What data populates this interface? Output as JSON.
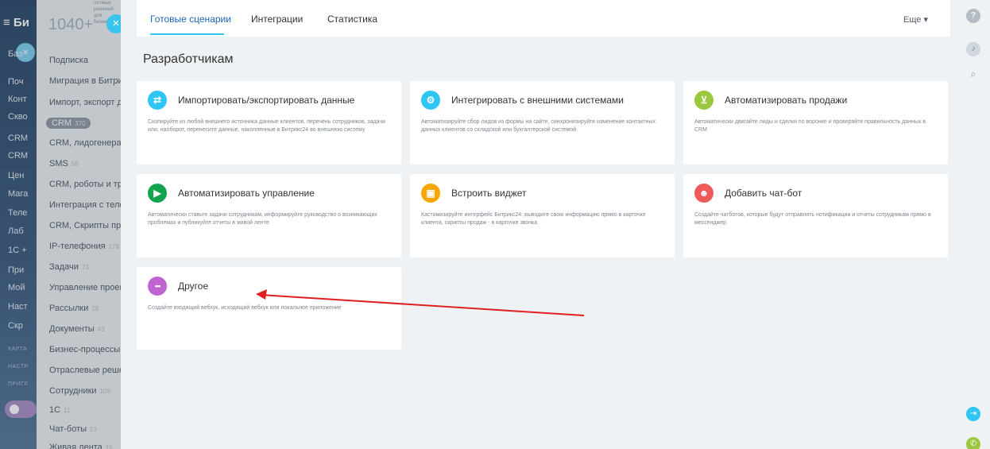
{
  "app_sidebar": {
    "brand": "≡ Би",
    "items": [
      "Баз",
      "Поч",
      "Конт",
      "Скво",
      "CRM",
      "CRM",
      "Цен",
      "Мага",
      "Теле",
      "Лаб",
      "1С +",
      "При",
      "Мой",
      "Наст",
      "Скр"
    ],
    "small_labels": [
      "КАРТА",
      "НАСТР",
      "ПРИГЛ"
    ],
    "close_glyph": "×"
  },
  "menu": {
    "count": "1040+",
    "count_desc": "готовых решений для Бизнеса",
    "close_glyph": "×",
    "items": [
      {
        "label": "Подписка",
        "count": ""
      },
      {
        "label": "Миграция в Битрикс",
        "count": ""
      },
      {
        "label": "Импорт, экспорт дан",
        "count": ""
      },
      {
        "label": "CRM",
        "count": "370"
      },
      {
        "label": "CRM, лидогенерация",
        "count": ""
      },
      {
        "label": "SMS",
        "count": "58"
      },
      {
        "label": "CRM, роботы и триг",
        "count": ""
      },
      {
        "label": "Интеграция с телеф",
        "count": ""
      },
      {
        "label": "CRM, Скрипты прод",
        "count": ""
      },
      {
        "label": "IP-телефония",
        "count": "178"
      },
      {
        "label": "Задачи",
        "count": "73"
      },
      {
        "label": "Управление проекта",
        "count": ""
      },
      {
        "label": "Рассылки",
        "count": "28"
      },
      {
        "label": "Документы",
        "count": "43"
      },
      {
        "label": "Бизнес-процессы",
        "count": "85"
      },
      {
        "label": "Отраслевые решени",
        "count": ""
      },
      {
        "label": "Сотрудники",
        "count": "109"
      },
      {
        "label": "1С",
        "count": "11"
      },
      {
        "label": "Чат-боты",
        "count": "53"
      },
      {
        "label": "Живая лента",
        "count": "16"
      }
    ]
  },
  "tabs": [
    {
      "label": "Готовые сценарии",
      "active": true
    },
    {
      "label": "Интеграции",
      "active": false
    },
    {
      "label": "Статистика",
      "active": false
    }
  ],
  "more_label": "Еще ▾",
  "page_title": "Разработчикам",
  "cards": [
    {
      "title": "Импортировать/экспортировать данные",
      "desc": "Скопируйте из любой внешнего источника данные клиентов, перечень сотрудников, задачи или, наоборот, перенесите данные, накопленные в Битрикс24 во внешнюю систему",
      "icon": "swap-icon",
      "glyph": "⇄",
      "color": "#2fc6f6"
    },
    {
      "title": "Интегрировать с внешними системами",
      "desc": "Автоматизируйте сбор лидов из формы на сайте, синхронизируйте изменение контактных данных клиентов со складской или бухгалтерской системой",
      "icon": "gears-icon",
      "glyph": "⚙",
      "color": "#2fc6f6"
    },
    {
      "title": "Автоматизировать продажи",
      "desc": "Автоматически двигайте лиды и сделки по воронке и проверяйте правильность данных в CRM",
      "icon": "cart-icon",
      "glyph": "⊻",
      "color": "#9bc83e"
    },
    {
      "title": "Автоматизировать управление",
      "desc": "Автоматически ставьте задачи сотрудникам, информируйте руководство о возникающих проблемах и публикуйте отчеты в живой ленте",
      "icon": "play-icon",
      "glyph": "▶",
      "color": "#12a44e"
    },
    {
      "title": "Встроить виджет",
      "desc": "Кастомизируйте интерфейс Битрикс24: выводите свою информацию прямо в карточке клиента, скрипты продаж - в карточке звонка",
      "icon": "widget-icon",
      "glyph": "▣",
      "color": "#f7a700"
    },
    {
      "title": "Добавить чат-бот",
      "desc": "Создайте чатботов, которые будут отправлять нотификации и отчеты сотрудникам прямо в мессенджер",
      "icon": "robot-icon",
      "glyph": "☻",
      "color": "#ef5a5a"
    },
    {
      "title": "Другое",
      "desc": "Создайте входящий вебхук, исходящий вебхук или локальное приложение",
      "icon": "more-dots-icon",
      "glyph": "•••",
      "color": "#c064d1"
    }
  ],
  "right_bar": {
    "help": "?",
    "bell": "♪",
    "search": "⌕",
    "login": "⇥",
    "phone": "✆"
  },
  "annotation_color": "#e02020"
}
